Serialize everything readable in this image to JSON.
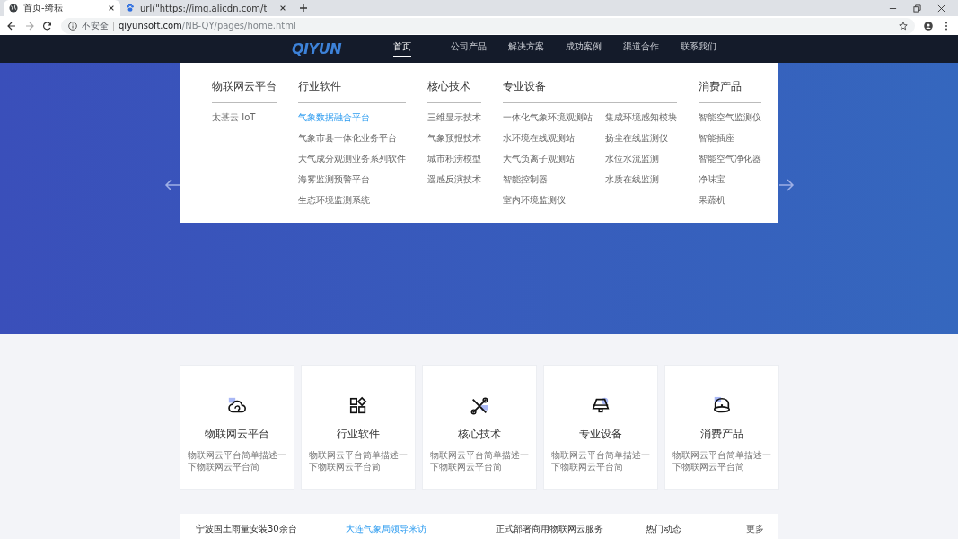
{
  "browser": {
    "tabs": [
      {
        "title": "首页-绮耘",
        "selected": true,
        "kind": "globe"
      },
      {
        "title": "url(\"https://img.alicdn.com/t",
        "selected": false,
        "kind": "paw"
      }
    ],
    "address": {
      "security": "不安全",
      "domain": "qiyunsoft.com",
      "path": "/NB-QY/pages/home.html"
    }
  },
  "site": {
    "logo": "QIYUN",
    "nav": [
      {
        "label": "首页",
        "selected": true
      },
      {
        "label": "公司产品",
        "selected": false
      },
      {
        "label": "解决方案",
        "selected": false
      },
      {
        "label": "成功案例",
        "selected": false
      },
      {
        "label": "渠道合作",
        "selected": false
      },
      {
        "label": "联系我们",
        "selected": false
      }
    ]
  },
  "dropdown": {
    "columns": [
      {
        "title": "物联网云平台",
        "items": [
          {
            "label": "太基云 IoT",
            "selected": false
          }
        ]
      },
      {
        "title": "行业软件",
        "items": [
          {
            "label": "气象数据融合平台",
            "selected": true
          },
          {
            "label": "气象市县一体化业务平台",
            "selected": false
          },
          {
            "label": "大气成分观测业务系列软件",
            "selected": false
          },
          {
            "label": "海雾监测预警平台",
            "selected": false
          },
          {
            "label": "生态环境监测系统",
            "selected": false
          }
        ]
      },
      {
        "title": "核心技术",
        "items": [
          {
            "label": "三维显示技术",
            "selected": false
          },
          {
            "label": "气象预报技术",
            "selected": false
          },
          {
            "label": "城市积涝模型",
            "selected": false
          },
          {
            "label": "遥感反演技术",
            "selected": false
          }
        ]
      },
      {
        "title": "专业设备",
        "items": [
          {
            "label": "一体化气象环境观测站",
            "selected": false
          },
          {
            "label": "水环境在线观测站",
            "selected": false
          },
          {
            "label": "大气负离子观测站",
            "selected": false
          },
          {
            "label": "智能控制器",
            "selected": false
          },
          {
            "label": "室内环境监测仪",
            "selected": false
          },
          {
            "label": "集成环境感知模块",
            "selected": false
          },
          {
            "label": "扬尘在线监测仪",
            "selected": false
          },
          {
            "label": "水位水流监测",
            "selected": false
          },
          {
            "label": "水质在线监测",
            "selected": false
          }
        ]
      },
      {
        "title": "消费产品",
        "items": [
          {
            "label": "智能空气监测仪",
            "selected": false
          },
          {
            "label": "智能插座",
            "selected": false
          },
          {
            "label": "智能空气净化器",
            "selected": false
          },
          {
            "label": "净味宝",
            "selected": false
          },
          {
            "label": "果蔬机",
            "selected": false
          }
        ]
      }
    ]
  },
  "features": [
    {
      "kind": "cloud",
      "title": "物联网云平台",
      "description": "物联网云平台简单描述一下物联网云平台简"
    },
    {
      "kind": "apps",
      "title": "行业软件",
      "description": "物联网云平台简单描述一下物联网云平台简"
    },
    {
      "kind": "tools",
      "title": "核心技术",
      "description": "物联网云平台简单描述一下物联网云平台简"
    },
    {
      "kind": "device",
      "title": "专业设备",
      "description": "物联网云平台简单描述一下物联网云平台简"
    },
    {
      "kind": "dome",
      "title": "消费产品",
      "description": "物联网云平台简单描述一下物联网云平台简"
    }
  ],
  "news": {
    "items": [
      {
        "text": "宁波国土雨量安装30余台",
        "selected": false
      },
      {
        "text": "大连气象局领导来访",
        "selected": true
      },
      {
        "text": "正式部署商用物联网云服务",
        "selected": false
      }
    ],
    "heading": "热门动态",
    "more": "更多"
  }
}
